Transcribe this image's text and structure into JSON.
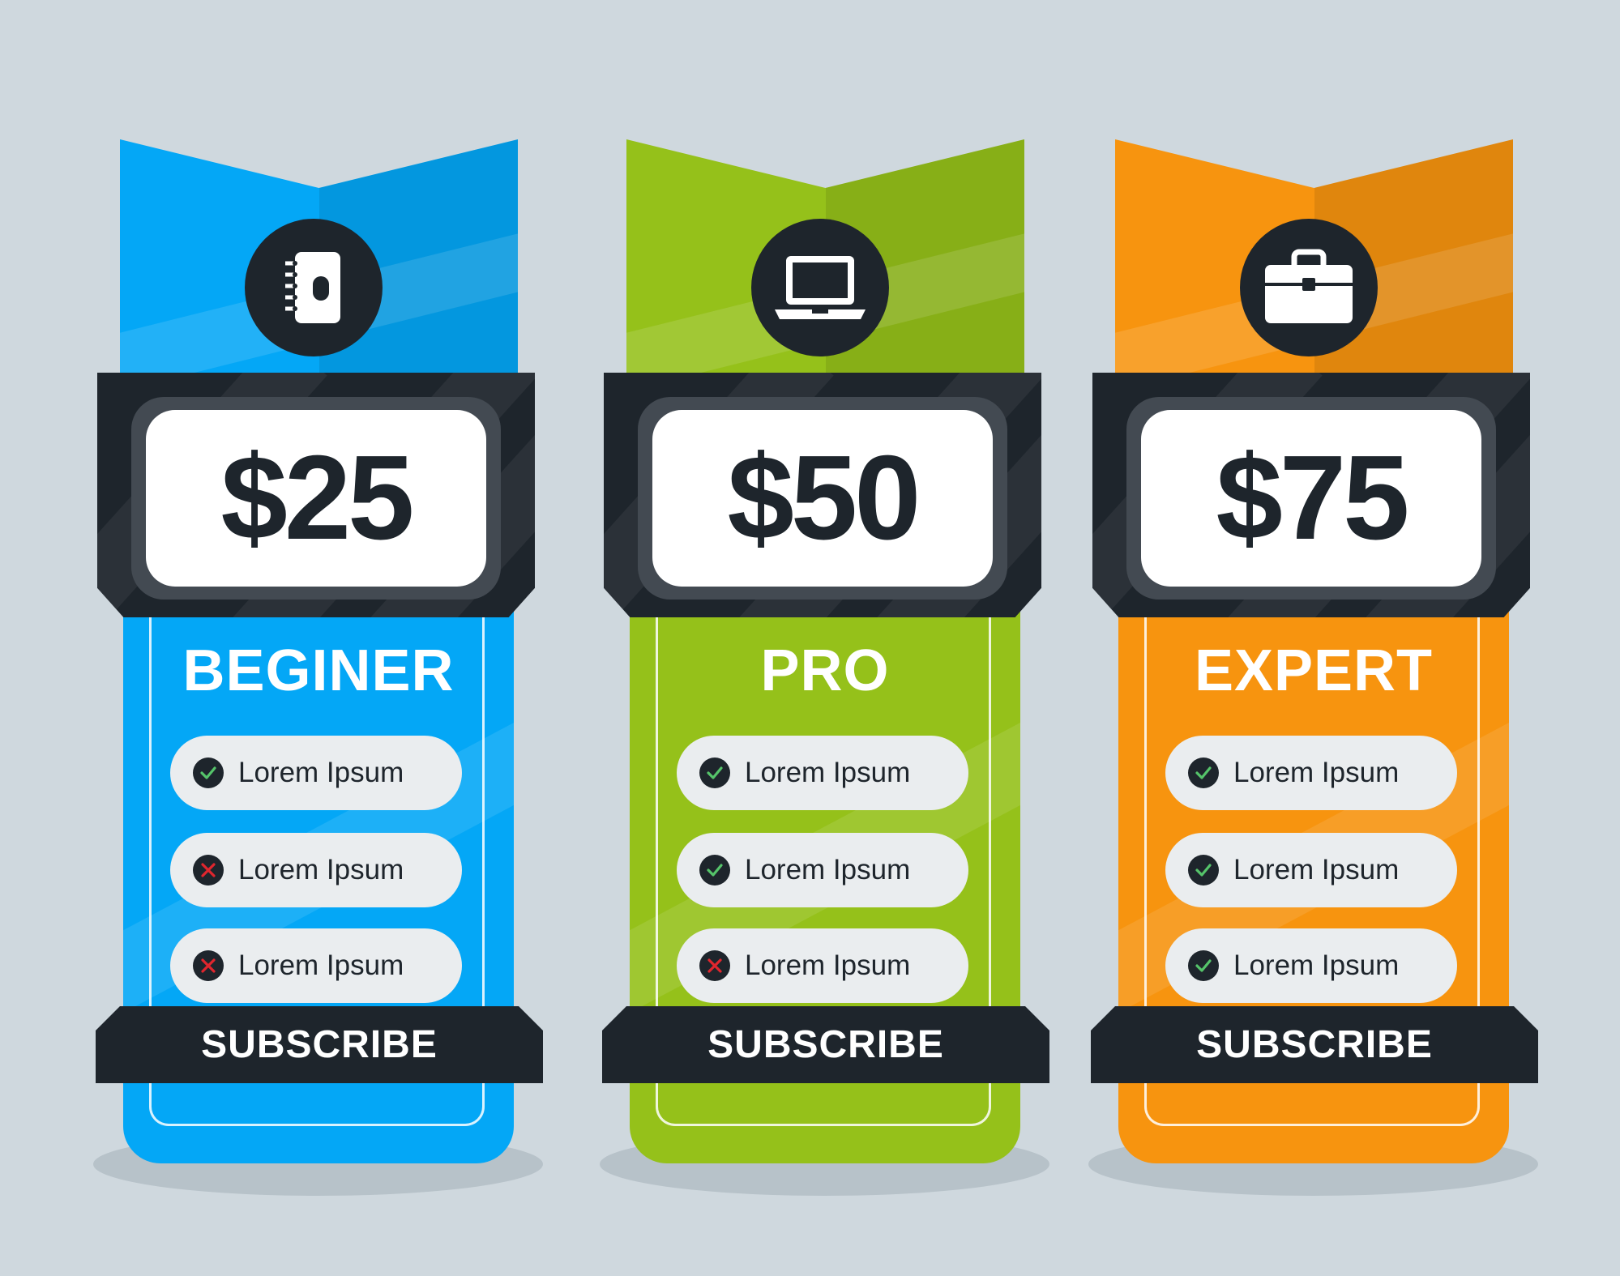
{
  "colors": {
    "background": "#cfd8de",
    "dark": "#1e252c",
    "check": "#55c46a",
    "cross": "#e0262e"
  },
  "plans": [
    {
      "name": "BEGINER",
      "price": "$25",
      "icon": "notebook-icon",
      "color": "#04a7f6",
      "features": [
        {
          "label": "Lorem Ipsum",
          "status": "check"
        },
        {
          "label": "Lorem Ipsum",
          "status": "cross"
        },
        {
          "label": "Lorem Ipsum",
          "status": "cross"
        }
      ],
      "button": "SUBSCRIBE"
    },
    {
      "name": "PRO",
      "price": "$50",
      "icon": "laptop-icon",
      "color": "#95c11a",
      "features": [
        {
          "label": "Lorem Ipsum",
          "status": "check"
        },
        {
          "label": "Lorem Ipsum",
          "status": "check"
        },
        {
          "label": "Lorem Ipsum",
          "status": "cross"
        }
      ],
      "button": "SUBSCRIBE"
    },
    {
      "name": "EXPERT",
      "price": "$75",
      "icon": "briefcase-icon",
      "color": "#f7940f",
      "features": [
        {
          "label": "Lorem Ipsum",
          "status": "check"
        },
        {
          "label": "Lorem Ipsum",
          "status": "check"
        },
        {
          "label": "Lorem Ipsum",
          "status": "check"
        }
      ],
      "button": "SUBSCRIBE"
    }
  ]
}
